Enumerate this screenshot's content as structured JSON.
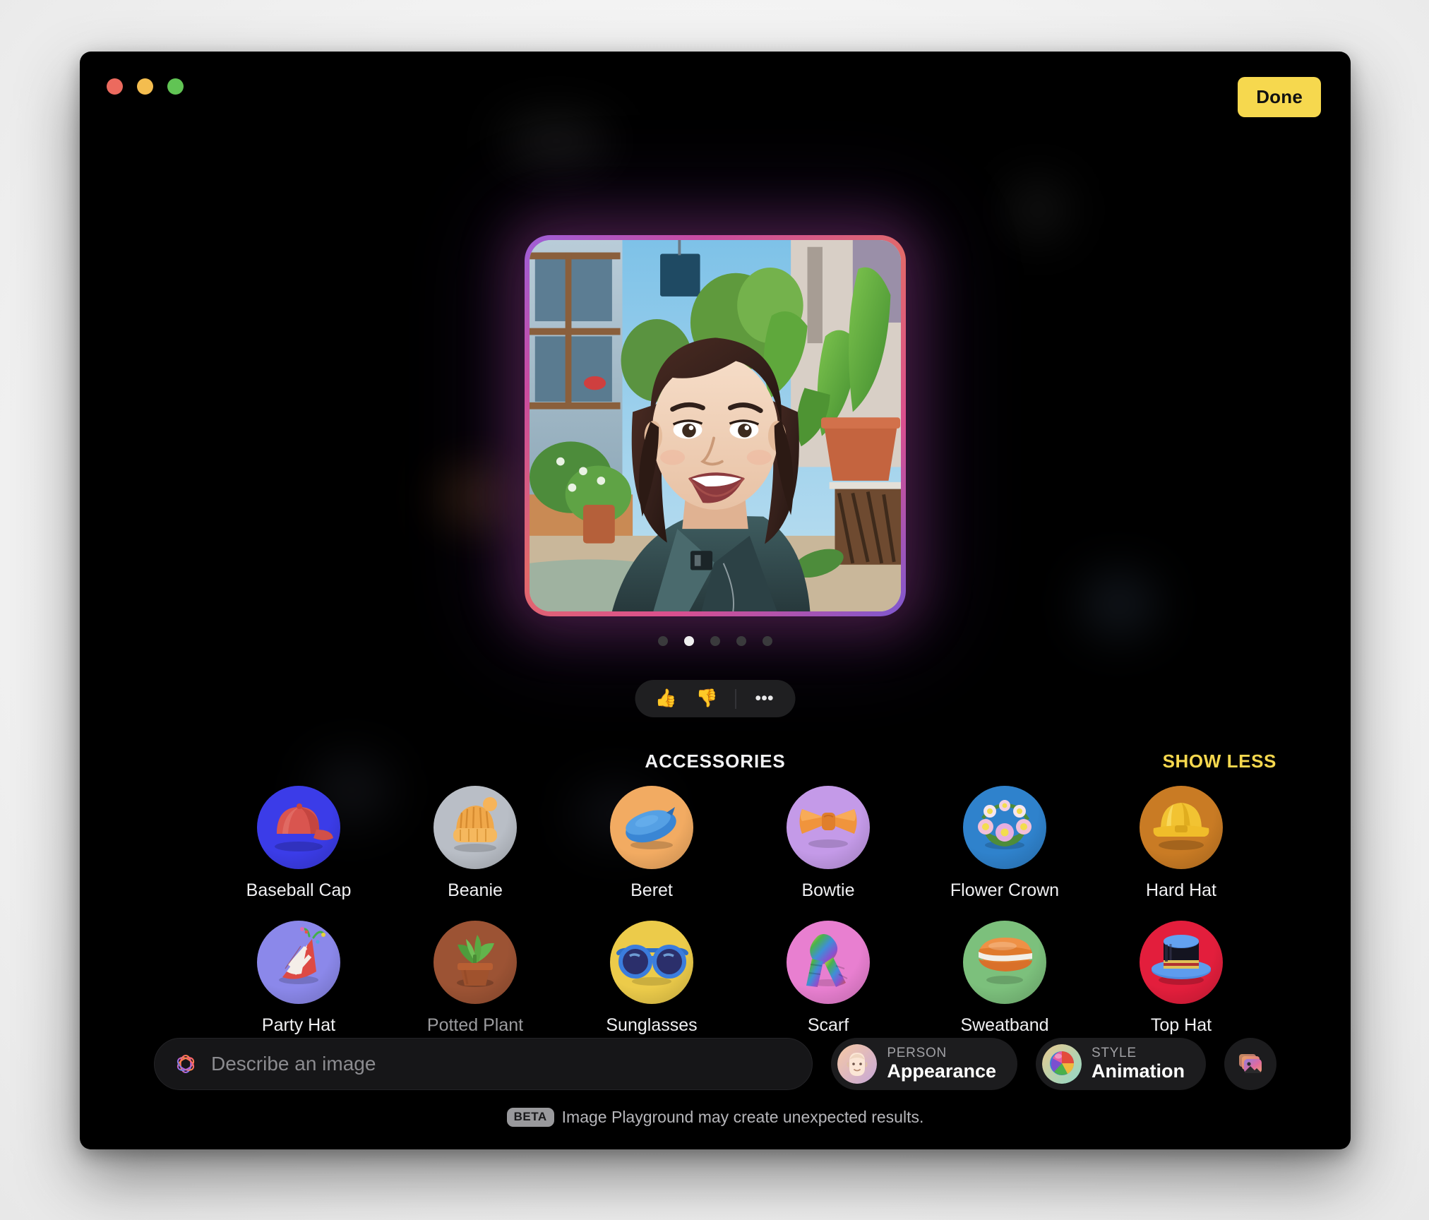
{
  "window": {
    "traffic_lights": [
      {
        "name": "close",
        "color": "#ec6a5e"
      },
      {
        "name": "minimize",
        "color": "#f4bd4f"
      },
      {
        "name": "zoom",
        "color": "#61c454"
      }
    ],
    "done_label": "Done",
    "done_color": "#f6d84e"
  },
  "carousel": {
    "prev_arrow": "‹",
    "next_arrow": "›",
    "image_alt": "Animated portrait of a smiling woman with dark wavy hair wearing a teal jacket, outdoors with potted plants and buildings",
    "page_count": 5,
    "active_page": 2
  },
  "feedback": {
    "thumbs_up": "👍",
    "thumbs_down": "👎",
    "more": "•••"
  },
  "accessories": {
    "title": "ACCESSORIES",
    "show_less_label": "SHOW LESS",
    "show_less_color": "#f6d84e",
    "items": [
      {
        "label": "Baseball Cap",
        "icon": "baseball-cap-icon",
        "bg": "#3b3ce8",
        "dimmed": false
      },
      {
        "label": "Beanie",
        "icon": "beanie-icon",
        "bg": "#b9bec6",
        "dimmed": false
      },
      {
        "label": "Beret",
        "icon": "beret-icon",
        "bg": "#f2ab62",
        "dimmed": false
      },
      {
        "label": "Bowtie",
        "icon": "bowtie-icon",
        "bg": "#c49ae8",
        "dimmed": false
      },
      {
        "label": "Flower Crown",
        "icon": "flower-crown-icon",
        "bg": "#2f82cc",
        "dimmed": false
      },
      {
        "label": "Hard Hat",
        "icon": "hard-hat-icon",
        "bg": "#c97b24",
        "dimmed": false
      },
      {
        "label": "Party Hat",
        "icon": "party-hat-icon",
        "bg": "#8b88ea",
        "dimmed": false
      },
      {
        "label": "Potted Plant",
        "icon": "potted-plant-icon",
        "bg": "#9c5334",
        "dimmed": true
      },
      {
        "label": "Sunglasses",
        "icon": "sunglasses-icon",
        "bg": "#eccb4a",
        "dimmed": false
      },
      {
        "label": "Scarf",
        "icon": "scarf-icon",
        "bg": "#e87fd0",
        "dimmed": false
      },
      {
        "label": "Sweatband",
        "icon": "sweatband-icon",
        "bg": "#7cc07c",
        "dimmed": false
      },
      {
        "label": "Top Hat",
        "icon": "top-hat-icon",
        "bg": "#e31e3c",
        "dimmed": false
      }
    ]
  },
  "bottom_bar": {
    "describe_placeholder": "Describe an image",
    "describe_value": "",
    "describe_icon": "apple-intelligence-icon",
    "person_chip": {
      "kicker": "PERSON",
      "value": "Appearance",
      "icon": "person-face-icon"
    },
    "style_chip": {
      "kicker": "STYLE",
      "value": "Animation",
      "icon": "style-ball-icon"
    },
    "photo_picker_icon": "photos-stack-icon"
  },
  "footer": {
    "badge": "BETA",
    "text": "Image Playground may create unexpected results."
  }
}
